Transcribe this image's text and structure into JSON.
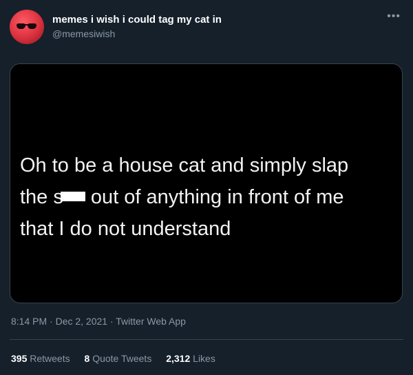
{
  "tweet": {
    "display_name": "memes i wish i could tag my cat in",
    "handle": "@memesiwish",
    "more_icon": "•••",
    "media": {
      "line1": "Oh to be a house cat and simply slap",
      "line2_start": "the s",
      "line2_end": " out of anything in front of me",
      "line3": "that I do not understand"
    },
    "timestamp": "8:14 PM · Dec 2, 2021 · Twitter Web App",
    "stats": [
      {
        "count": "395",
        "label": "Retweets"
      },
      {
        "count": "8",
        "label": "Quote Tweets"
      },
      {
        "count": "2,312",
        "label": "Likes"
      }
    ]
  },
  "colors": {
    "background": "#15202b",
    "secondary_text": "#8b98a5",
    "border": "#38444d"
  }
}
